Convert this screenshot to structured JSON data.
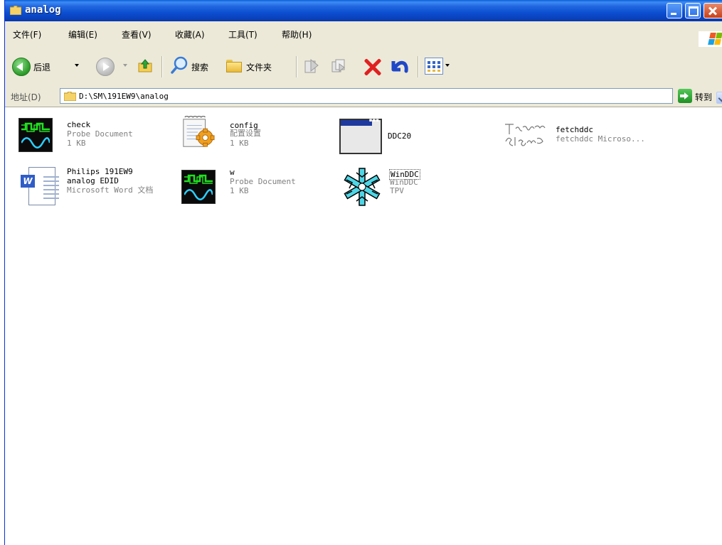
{
  "window": {
    "title": "analog"
  },
  "menu": {
    "items": [
      "文件(F)",
      "编辑(E)",
      "查看(V)",
      "收藏(A)",
      "工具(T)",
      "帮助(H)"
    ]
  },
  "toolbar": {
    "back_label": "后退",
    "search_label": "搜索",
    "folders_label": "文件夹"
  },
  "address": {
    "label": "地址(D)",
    "path": "D:\\SM\\191EW9\\analog",
    "go_label": "转到"
  },
  "files": [
    {
      "name": "check",
      "line2": "Probe Document",
      "line3": "1 KB",
      "icon": "probe-document-icon"
    },
    {
      "name": "config",
      "line2": "配置设置",
      "line3": "1 KB",
      "icon": "config-settings-icon"
    },
    {
      "name": "DDC20",
      "line2": "",
      "line3": "",
      "icon": "application-window-icon"
    },
    {
      "name": "fetchddc",
      "line2": "fetchddc Microso...",
      "line3": "",
      "icon": "handwriting-logo-icon",
      "logo_text": "Tom Slake"
    },
    {
      "name": "Philips 191EW9",
      "line2": "analog EDID",
      "line3": "Microsoft Word 文档",
      "icon": "word-document-icon"
    },
    {
      "name": "w",
      "line2": "Probe Document",
      "line3": "1 KB",
      "icon": "probe-document-icon"
    },
    {
      "name": "WinDDC",
      "line2": "WinDDC",
      "line3": "TPV",
      "icon": "snowflake-icon"
    }
  ],
  "colors": {
    "titlebar": "#0a5ed6",
    "chrome": "#ece9d8",
    "selection_border": "#555555"
  }
}
